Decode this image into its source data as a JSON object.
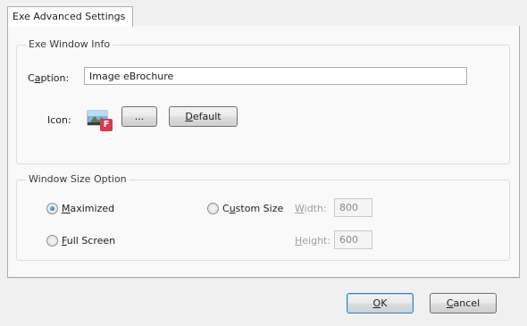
{
  "tab": {
    "label": "Exe Advanced Settings"
  },
  "window_info": {
    "title": "Exe Window Info",
    "caption_label_pre": "C",
    "caption_label_acc": "a",
    "caption_label_post": "ption:",
    "caption_value": "Image eBrochure",
    "icon_label": "Icon:",
    "icon_badge": "F",
    "browse_label": "...",
    "default_label_acc": "D",
    "default_label_post": "efault"
  },
  "size_option": {
    "title": "Window Size Option",
    "maximized_acc": "M",
    "maximized_post": "aximized",
    "maximized_selected": true,
    "fullscreen_acc": "F",
    "fullscreen_post": "ull Screen",
    "custom_pre": "C",
    "custom_acc": "u",
    "custom_post": "stom Size",
    "width_acc": "W",
    "width_post": "idth:",
    "width_value": "800",
    "height_acc": "H",
    "height_post": "eight:",
    "height_value": "600"
  },
  "footer": {
    "ok_acc": "O",
    "ok_post": "K",
    "cancel_acc": "C",
    "cancel_post": "ancel"
  }
}
